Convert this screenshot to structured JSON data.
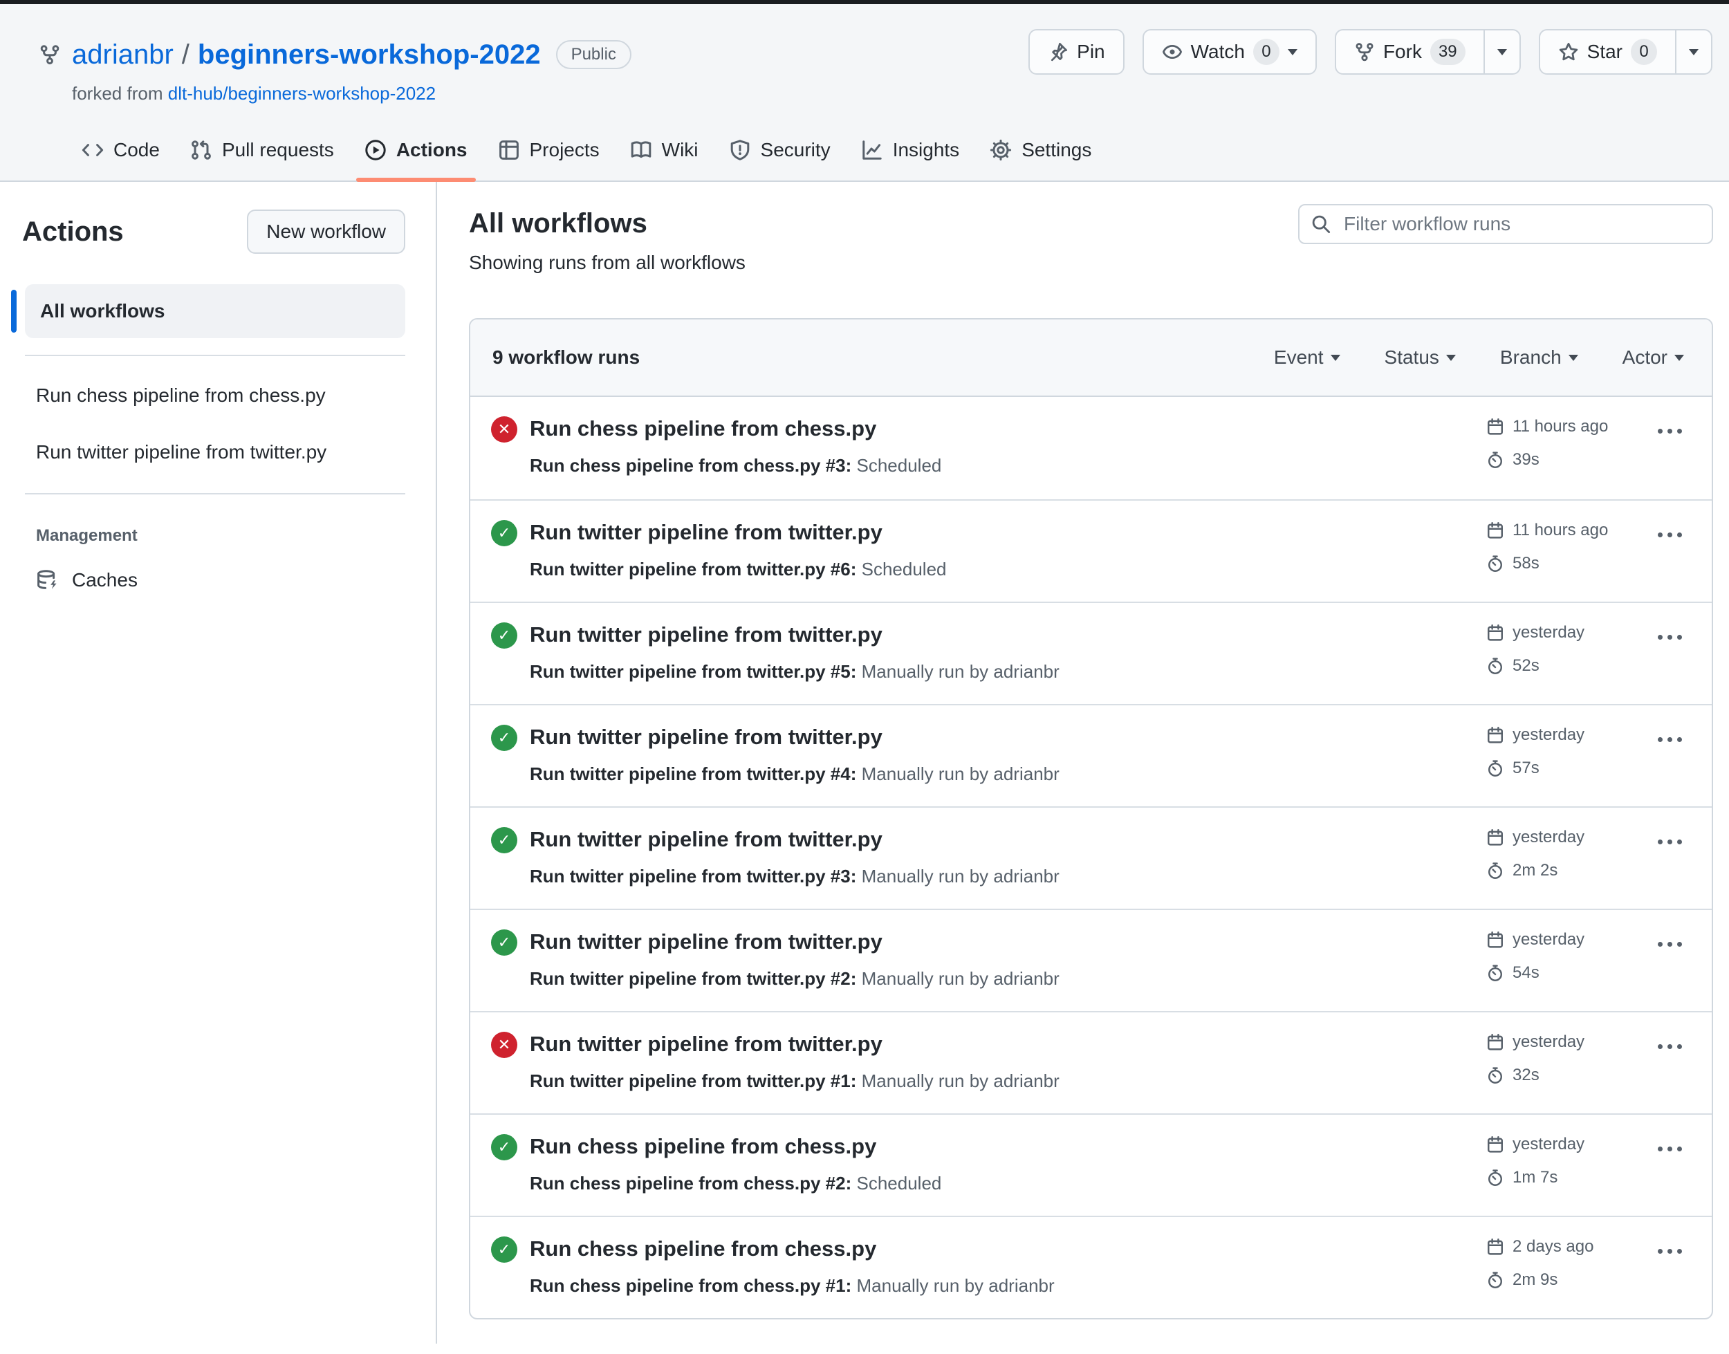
{
  "repo_header": {
    "owner": "adrianbr",
    "separator": "/",
    "name": "beginners-workshop-2022",
    "visibility": "Public",
    "forked_from_label": "forked from",
    "forked_from_link": "dlt-hub/beginners-workshop-2022",
    "buttons": {
      "pin": "Pin",
      "watch": "Watch",
      "watch_count": "0",
      "fork": "Fork",
      "fork_count": "39",
      "star": "Star",
      "star_count": "0"
    }
  },
  "nav": {
    "tabs": [
      {
        "label": "Code"
      },
      {
        "label": "Pull requests"
      },
      {
        "label": "Actions",
        "active": true
      },
      {
        "label": "Projects"
      },
      {
        "label": "Wiki"
      },
      {
        "label": "Security"
      },
      {
        "label": "Insights"
      },
      {
        "label": "Settings"
      }
    ]
  },
  "sidebar": {
    "title": "Actions",
    "new_workflow_label": "New workflow",
    "all_workflows_label": "All workflows",
    "workflows": [
      "Run chess pipeline from chess.py",
      "Run twitter pipeline from twitter.py"
    ],
    "management_label": "Management",
    "caches_label": "Caches"
  },
  "main": {
    "title": "All workflows",
    "subtitle": "Showing runs from all workflows",
    "filter_placeholder": "Filter workflow runs",
    "runs_header": {
      "count_label": "9 workflow runs",
      "filters": [
        "Event",
        "Status",
        "Branch",
        "Actor"
      ]
    },
    "runs": [
      {
        "status": "failure",
        "title": "Run chess pipeline from chess.py",
        "run_ref": "Run chess pipeline from chess.py #3:",
        "event_desc": "Scheduled",
        "date": "11 hours ago",
        "duration": "39s"
      },
      {
        "status": "success",
        "title": "Run twitter pipeline from twitter.py",
        "run_ref": "Run twitter pipeline from twitter.py #6:",
        "event_desc": "Scheduled",
        "date": "11 hours ago",
        "duration": "58s"
      },
      {
        "status": "success",
        "title": "Run twitter pipeline from twitter.py",
        "run_ref": "Run twitter pipeline from twitter.py #5:",
        "event_desc": "Manually run by adrianbr",
        "date": "yesterday",
        "duration": "52s"
      },
      {
        "status": "success",
        "title": "Run twitter pipeline from twitter.py",
        "run_ref": "Run twitter pipeline from twitter.py #4:",
        "event_desc": "Manually run by adrianbr",
        "date": "yesterday",
        "duration": "57s"
      },
      {
        "status": "success",
        "title": "Run twitter pipeline from twitter.py",
        "run_ref": "Run twitter pipeline from twitter.py #3:",
        "event_desc": "Manually run by adrianbr",
        "date": "yesterday",
        "duration": "2m 2s"
      },
      {
        "status": "success",
        "title": "Run twitter pipeline from twitter.py",
        "run_ref": "Run twitter pipeline from twitter.py #2:",
        "event_desc": "Manually run by adrianbr",
        "date": "yesterday",
        "duration": "54s"
      },
      {
        "status": "failure",
        "title": "Run twitter pipeline from twitter.py",
        "run_ref": "Run twitter pipeline from twitter.py #1:",
        "event_desc": "Manually run by adrianbr",
        "date": "yesterday",
        "duration": "32s"
      },
      {
        "status": "success",
        "title": "Run chess pipeline from chess.py",
        "run_ref": "Run chess pipeline from chess.py #2:",
        "event_desc": "Scheduled",
        "date": "yesterday",
        "duration": "1m 7s"
      },
      {
        "status": "success",
        "title": "Run chess pipeline from chess.py",
        "run_ref": "Run chess pipeline from chess.py #1:",
        "event_desc": "Manually run by adrianbr",
        "date": "2 days ago",
        "duration": "2m 9s"
      }
    ]
  },
  "icons": {
    "success_glyph": "✓",
    "failure_glyph": "✕"
  },
  "colors": {
    "success_green": "#2c974b",
    "failure_red": "#cf222e",
    "link_blue": "#0969da",
    "active_tab_orange": "#fd8c73",
    "selected_item_blue": "#0969da",
    "border_gray": "#d0d7de"
  }
}
